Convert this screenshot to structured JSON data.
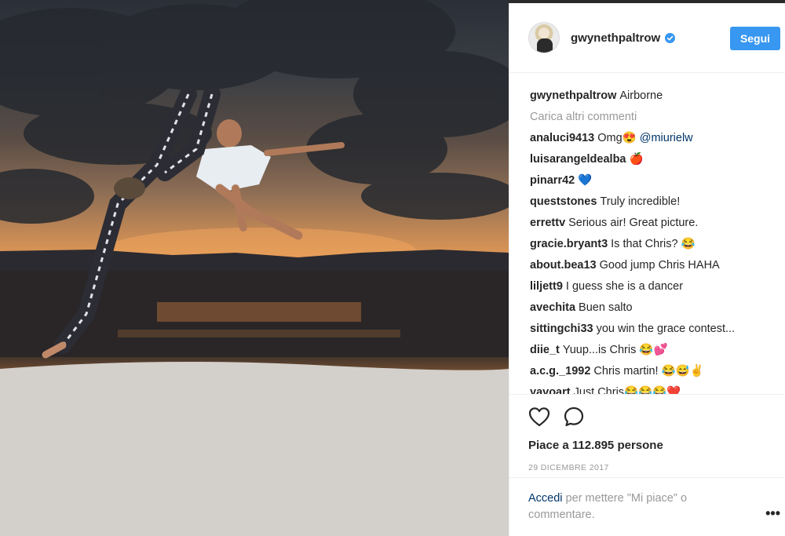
{
  "post": {
    "image_alt": "Airborne photo on beach at sunset"
  },
  "header": {
    "username": "gwynethpaltrow",
    "follow_label": "Segui"
  },
  "caption": {
    "user": "gwynethpaltrow",
    "text": "Airborne"
  },
  "load_more_label": "Carica altri commenti",
  "comments": [
    {
      "user": "analuci9413",
      "text": "Omg😍 ",
      "mention": "@miurielw"
    },
    {
      "user": "luisarangeldealba",
      "text": "🍎",
      "mention": ""
    },
    {
      "user": "pinarr42",
      "text": "💙",
      "mention": ""
    },
    {
      "user": "queststones",
      "text": "Truly incredible!",
      "mention": ""
    },
    {
      "user": "errettv",
      "text": "Serious air! Great picture.",
      "mention": ""
    },
    {
      "user": "gracie.bryant3",
      "text": "Is that Chris? 😂",
      "mention": ""
    },
    {
      "user": "about.bea13",
      "text": "Good jump Chris HAHA",
      "mention": ""
    },
    {
      "user": "liljett9",
      "text": "I guess she is a dancer",
      "mention": ""
    },
    {
      "user": "avechita",
      "text": "Buen salto",
      "mention": ""
    },
    {
      "user": "sittingchi33",
      "text": "you win the grace contest...",
      "mention": ""
    },
    {
      "user": "diie_t",
      "text": "Yuup...is Chris 😂💕",
      "mention": ""
    },
    {
      "user": "a.c.g._1992",
      "text": "Chris martin! 😂😅✌",
      "mention": ""
    },
    {
      "user": "yavoart",
      "text": "Just Chris😂😂😂❤️",
      "mention": ""
    }
  ],
  "actions": {
    "like_icon": "heart-outline-icon",
    "comment_icon": "speech-bubble-icon",
    "likes_text": "Piace a 112.895 persone",
    "date_text": "29 DICEMBRE 2017"
  },
  "footer": {
    "login_label": "Accedi",
    "rest_text": " per mettere \"Mi piace\" o commentare.",
    "more_label": "•••"
  },
  "colors": {
    "accent": "#3897f0",
    "link": "#003569",
    "muted": "#999999",
    "text": "#262626"
  }
}
